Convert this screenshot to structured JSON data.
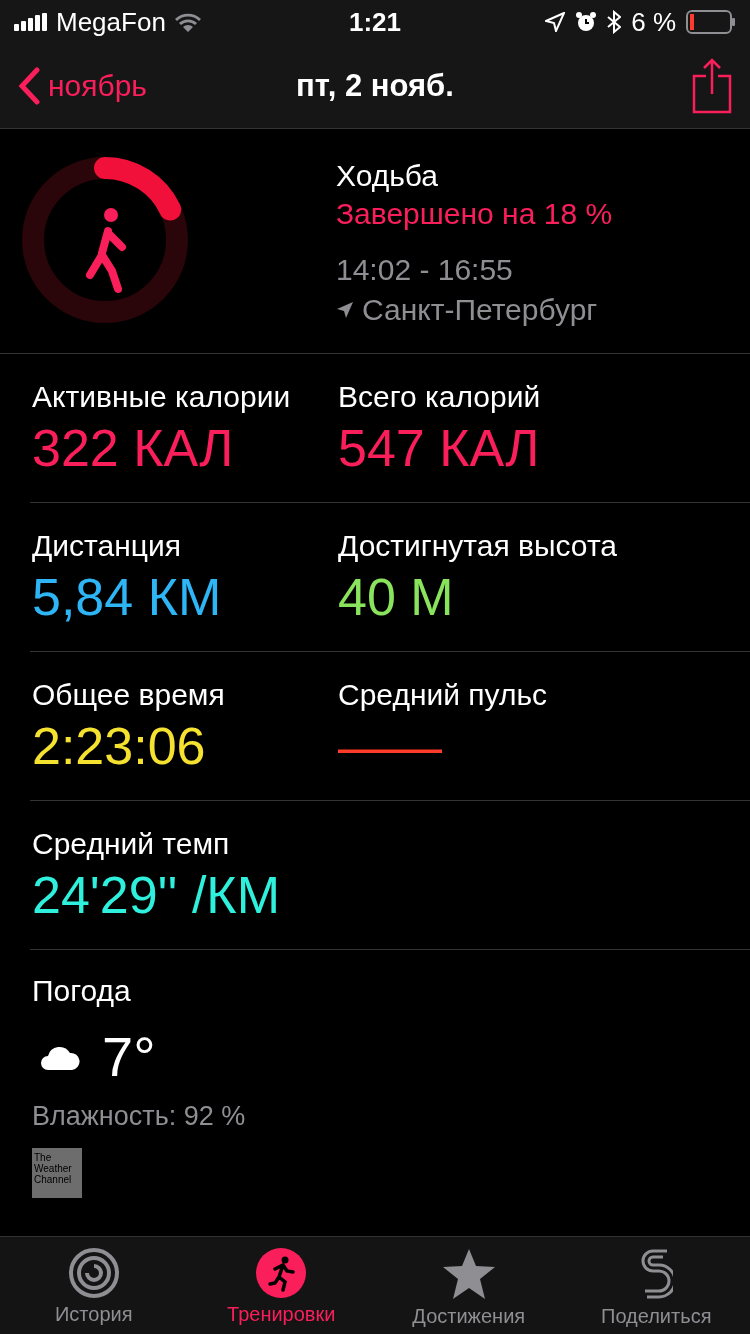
{
  "status_bar": {
    "carrier": "MegaFon",
    "time": "1:21",
    "battery": "6 %"
  },
  "nav": {
    "back": "ноябрь",
    "title": "пт, 2 нояб."
  },
  "workout": {
    "name": "Ходьба",
    "progress": "Завершено на 18 %",
    "level": 0.18,
    "time_range": "14:02 - 16:55",
    "location": "Санкт-Петербург"
  },
  "metric_rows": [
    {
      "metrics": [
        {
          "label": "Активные калории",
          "value": "322 КАЛ",
          "color": "#fa1e5a"
        },
        {
          "label": "Всего калорий",
          "value": "547 КАЛ",
          "color": "#fa1e5a"
        }
      ]
    },
    {
      "metrics": [
        {
          "label": "Дистанция",
          "value": "5,84 КМ",
          "color": "#2eb5f5"
        },
        {
          "label": "Достигнутая высота",
          "value": "40 М",
          "color": "#8ae35c"
        }
      ]
    },
    {
      "metrics": [
        {
          "label": "Общее время",
          "value": "2:23:06",
          "color": "#f5e12f"
        },
        {
          "label": "Средний пульс",
          "value": "——",
          "color": "#ff3b2a"
        }
      ]
    },
    {
      "metrics": [
        {
          "label": "Средний темп",
          "value": "24'29'' /КМ",
          "color": "#2ef0dc"
        }
      ]
    }
  ],
  "weather": {
    "title": "Погода",
    "temperature": "7°",
    "humidity": "Влажность: 92 %",
    "provider": "The Weather Channel"
  },
  "tabs": [
    {
      "label": "История",
      "kind": "history",
      "selected": false
    },
    {
      "label": "Тренировки",
      "kind": "workouts",
      "selected": true
    },
    {
      "label": "Достижения",
      "kind": "awards",
      "selected": false
    },
    {
      "label": "Поделиться",
      "kind": "sharing",
      "selected": false
    }
  ]
}
